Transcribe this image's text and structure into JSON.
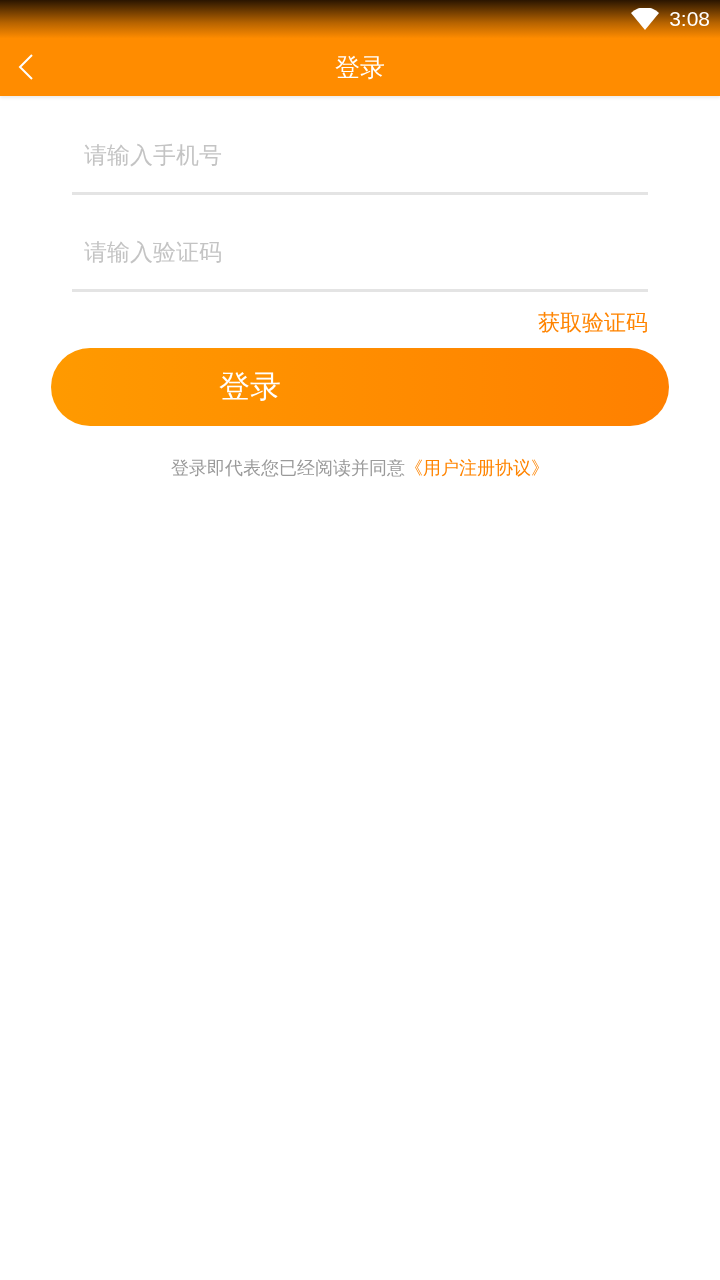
{
  "status_bar": {
    "time": "3:08"
  },
  "header": {
    "title": "登录"
  },
  "fields": [
    {
      "placeholder": "请输入手机号"
    },
    {
      "placeholder": "请输入验证码"
    }
  ],
  "get_code_link": "获取验证码",
  "login_button": "登录",
  "agreement": {
    "text": "登录即代表您已经阅读并同意",
    "link": "《用户注册协议》"
  }
}
